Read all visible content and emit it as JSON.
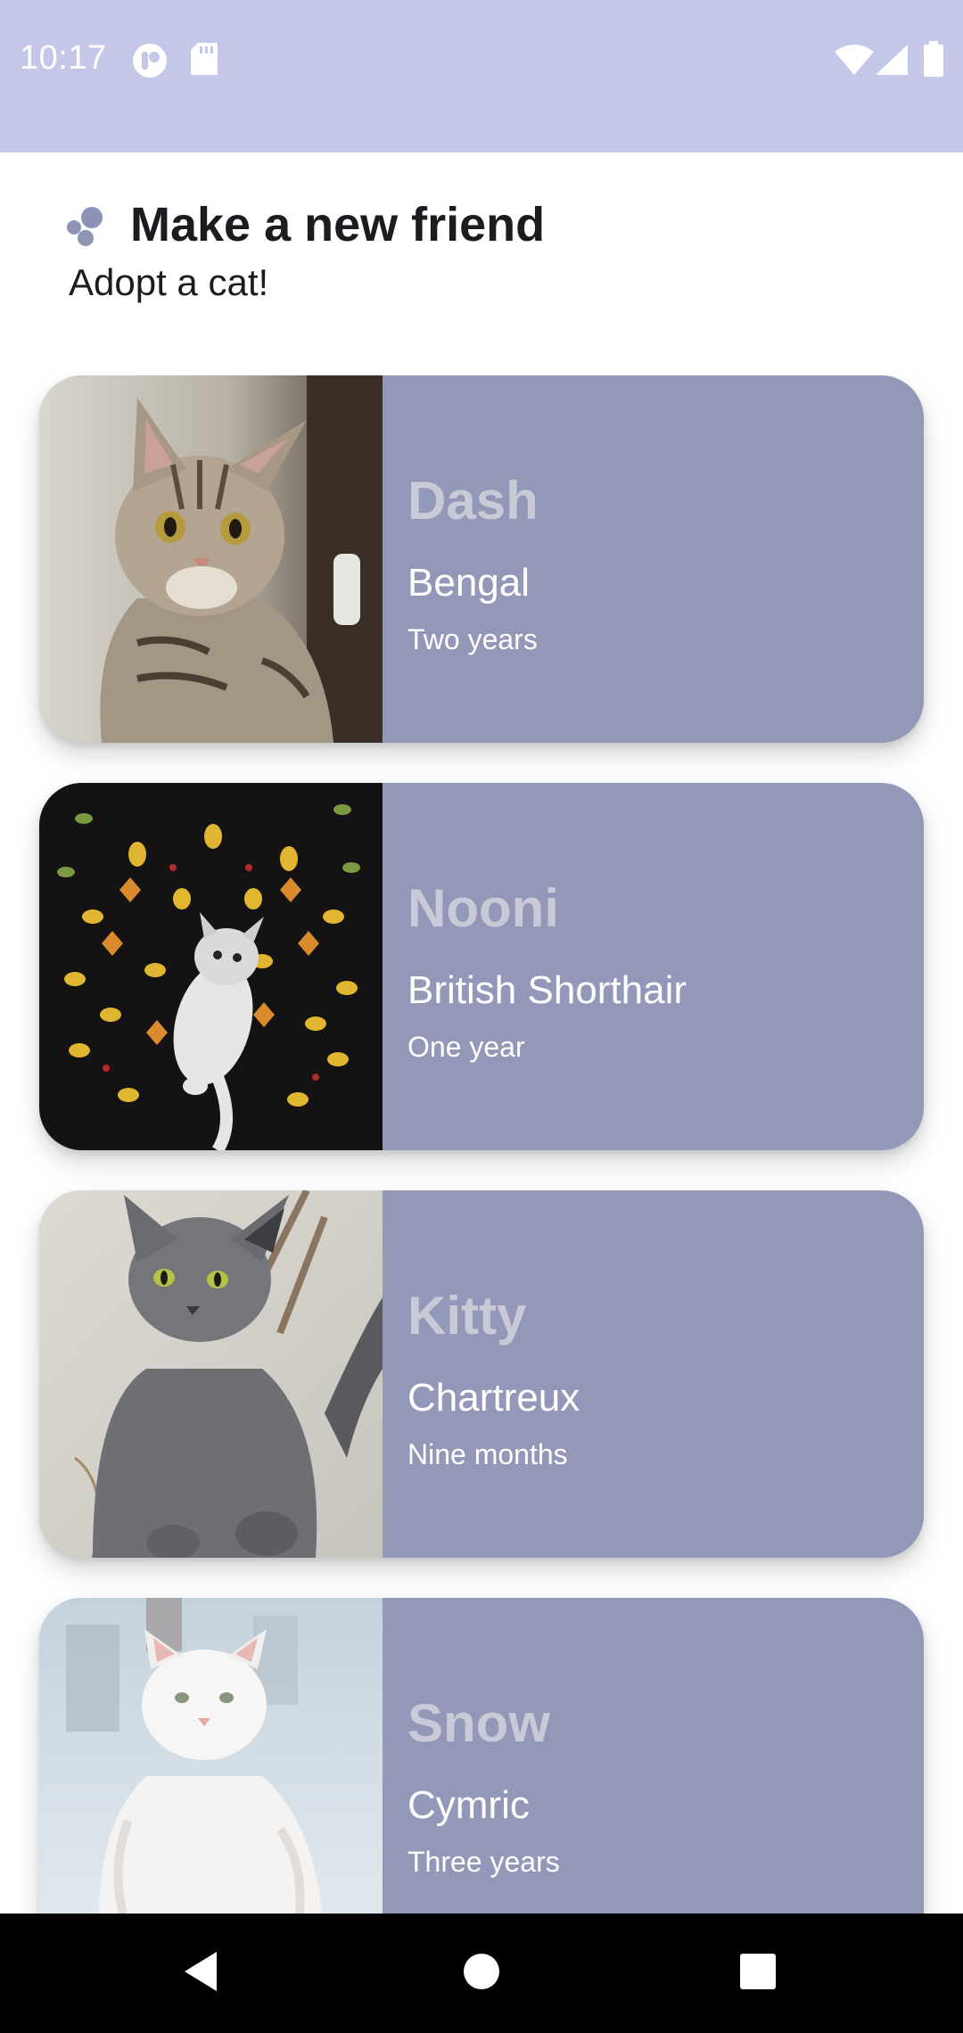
{
  "status_bar": {
    "time": "10:17",
    "icons": [
      "launcher-app-icon",
      "sd-card-icon",
      "wifi-icon",
      "cell-signal-icon",
      "battery-icon"
    ],
    "background_color": "#c5c7e8"
  },
  "header": {
    "title": "Make a new friend",
    "subtitle": "Adopt a cat!",
    "logo_icon": "paw-dots-icon"
  },
  "cats": [
    {
      "name": "Dash",
      "breed": "Bengal",
      "age": "Two years",
      "photo": "tabby-cat-photo"
    },
    {
      "name": "Nooni",
      "breed": "British Shorthair",
      "age": "One year",
      "photo": "white-kitten-leaves-photo"
    },
    {
      "name": "Kitty",
      "breed": "Chartreux",
      "age": "Nine months",
      "photo": "gray-cat-photo"
    },
    {
      "name": "Snow",
      "breed": "Cymric",
      "age": "Three years",
      "photo": "white-longhair-cat-photo"
    }
  ],
  "colors": {
    "card_background": "#9398b8",
    "name_text": "#c9cad8",
    "detail_text": "#ffffff"
  },
  "nav_bar": {
    "buttons": [
      "back-icon",
      "home-icon",
      "recents-icon"
    ]
  }
}
